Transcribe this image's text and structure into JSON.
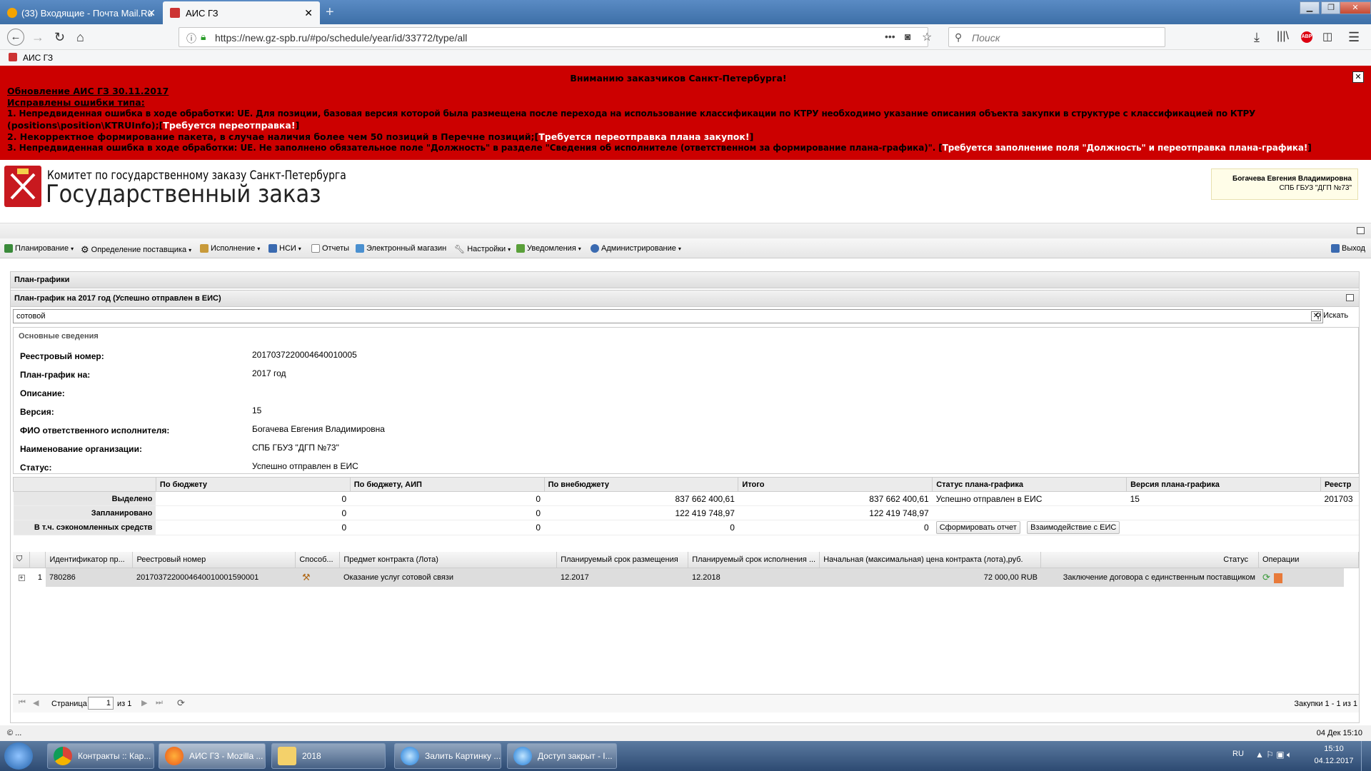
{
  "browser": {
    "tabs": [
      {
        "label": "(33) Входящие - Почта Mail.Ru"
      },
      {
        "label": "АИС ГЗ"
      }
    ],
    "new_tab": "+",
    "url": "https://new.gz-spb.ru/#po/schedule/year/id/33772/type/all",
    "search_placeholder": "Поиск",
    "bookmark": "АИС ГЗ"
  },
  "banner": {
    "title": "Вниманию заказчиков Санкт-Петербурга!",
    "update": "Обновление АИС ГЗ 30.11.2017",
    "fixed": "Исправлены ошибки типа:",
    "line1": "  1. Непредвиденная ошибка в ходе обработки: UE. Для позиции, базовая версия которой была размещена после перехода на использование классификации по КТРУ необходимо указание описания объекта закупки в структуре с классификацией по КТРУ",
    "line1b": "(positions\\position\\KTRUInfo);[",
    "line1b_white": "Требуется переотправка!",
    "line1b_end": "]",
    "line2": "  2. Некорректное формирование пакета, в случае наличия более чем 50 позиций в Перечне позиций;[",
    "line2_white": "Требуется переотправка плана закупок!",
    "line2_end": "]",
    "line3": "  3. Непредвиденная ошибка в ходе обработки: UE. Не заполнено обязательное поле \"Должность\" в разделе \"Сведения об исполнителе (ответственном за формирование плана-графика)\". [",
    "line3_white": "Требуется заполнение поля \"Должность\" и переотправка плана-графика!",
    "line3_end": "]",
    "close": "✕"
  },
  "header": {
    "org_line1": "Комитет по государственному заказу Санкт-Петербурга",
    "org_line2": "Государственный заказ",
    "user_name": "Богачева Евгения Владимировна",
    "user_org": "СПБ ГБУЗ \"ДГП №73\""
  },
  "menu": {
    "items": [
      {
        "label": "Планирование",
        "arrow": true
      },
      {
        "label": "Определение поставщика",
        "arrow": true
      },
      {
        "label": "Исполнение",
        "arrow": true
      },
      {
        "label": "НСИ",
        "arrow": true
      },
      {
        "label": "Отчеты",
        "arrow": false
      },
      {
        "label": "Электронный магазин",
        "arrow": false
      },
      {
        "label": "Настройки",
        "arrow": true
      },
      {
        "label": "Уведомления",
        "arrow": true
      },
      {
        "label": "Администрирование",
        "arrow": true
      }
    ],
    "logout": "Выход"
  },
  "page": {
    "section_title": "План-графики",
    "plan_title": "План-график на 2017 год (Успешно отправлен в ЕИС)",
    "search_value": "сотовой",
    "search_button": "Искать",
    "basic_info_title": "Основные сведения"
  },
  "fields": {
    "registry_label": "Реестровый номер:",
    "registry_value": "2017037220004640010005",
    "plan_for_label": "План-график на:",
    "plan_for_value": "2017 год",
    "description_label": "Описание:",
    "version_label": "Версия:",
    "version_value": "15",
    "fio_label": "ФИО ответственного исполнителя:",
    "fio_value": "Богачева Евгения Владимировна",
    "org_label": "Наименование организации:",
    "org_value": "СПБ ГБУЗ \"ДГП №73\"",
    "status_label": "Статус:",
    "status_value": "Успешно отправлен в ЕИС"
  },
  "summary": {
    "headers": [
      "По бюджету",
      "По бюджету, АИП",
      "По внебюджету",
      "Итого",
      "Статус плана-графика",
      "Версия плана-графика",
      "Реестр"
    ],
    "rows": [
      {
        "label": "Выделено",
        "values": [
          "0",
          "0",
          "837 662 400,61",
          "837 662 400,61"
        ],
        "status": "Успешно отправлен в ЕИС",
        "version": "15",
        "registry": "201703"
      },
      {
        "label": "Запланировано",
        "values": [
          "0",
          "0",
          "122 419 748,97",
          "122 419 748,97"
        ]
      },
      {
        "label": "В т.ч. сэкономленных средств",
        "values": [
          "0",
          "0",
          "0",
          "0"
        ]
      }
    ],
    "btn_report": "Сформировать отчет",
    "btn_eis": "Взаимодействие с ЕИС"
  },
  "grid": {
    "headers": [
      "Идентификатор пр...",
      "Реестровый номер",
      "Способ...",
      "Предмет контракта (Лота)",
      "Планируемый срок размещения",
      "Планируемый срок исполнения ...",
      "Начальная (максимальная) цена контракта (лота),руб.",
      "Статус",
      "Операции"
    ],
    "rows": [
      {
        "num": "1",
        "id": "780286",
        "registry": "2017037220004640010001590001",
        "subject": "Оказание услуг сотовой связи",
        "placement": "12.2017",
        "execution": "12.2018",
        "price": "72 000,00 RUB",
        "status": "Заключение договора с единственным поставщиком"
      }
    ],
    "expand": "+"
  },
  "pager": {
    "page_label": "Страница",
    "page_value": "1",
    "of_label": "из 1",
    "summary": "Закупки 1 - 1 из 1"
  },
  "statusbar": {
    "left": "...",
    "right": "04 Дек 15:10"
  },
  "taskbar": {
    "items": [
      {
        "label": "Контракты :: Кар..."
      },
      {
        "label": "АИС ГЗ - Mozilla ..."
      },
      {
        "label": "2018"
      },
      {
        "label": "Залить Картинку ..."
      },
      {
        "label": "Доступ закрыт - I..."
      }
    ],
    "lang": "RU",
    "time": "15:10",
    "date": "04.12.2017"
  },
  "colors": {
    "banner_bg": "#cc0000",
    "accent": "#3d6fa7"
  }
}
